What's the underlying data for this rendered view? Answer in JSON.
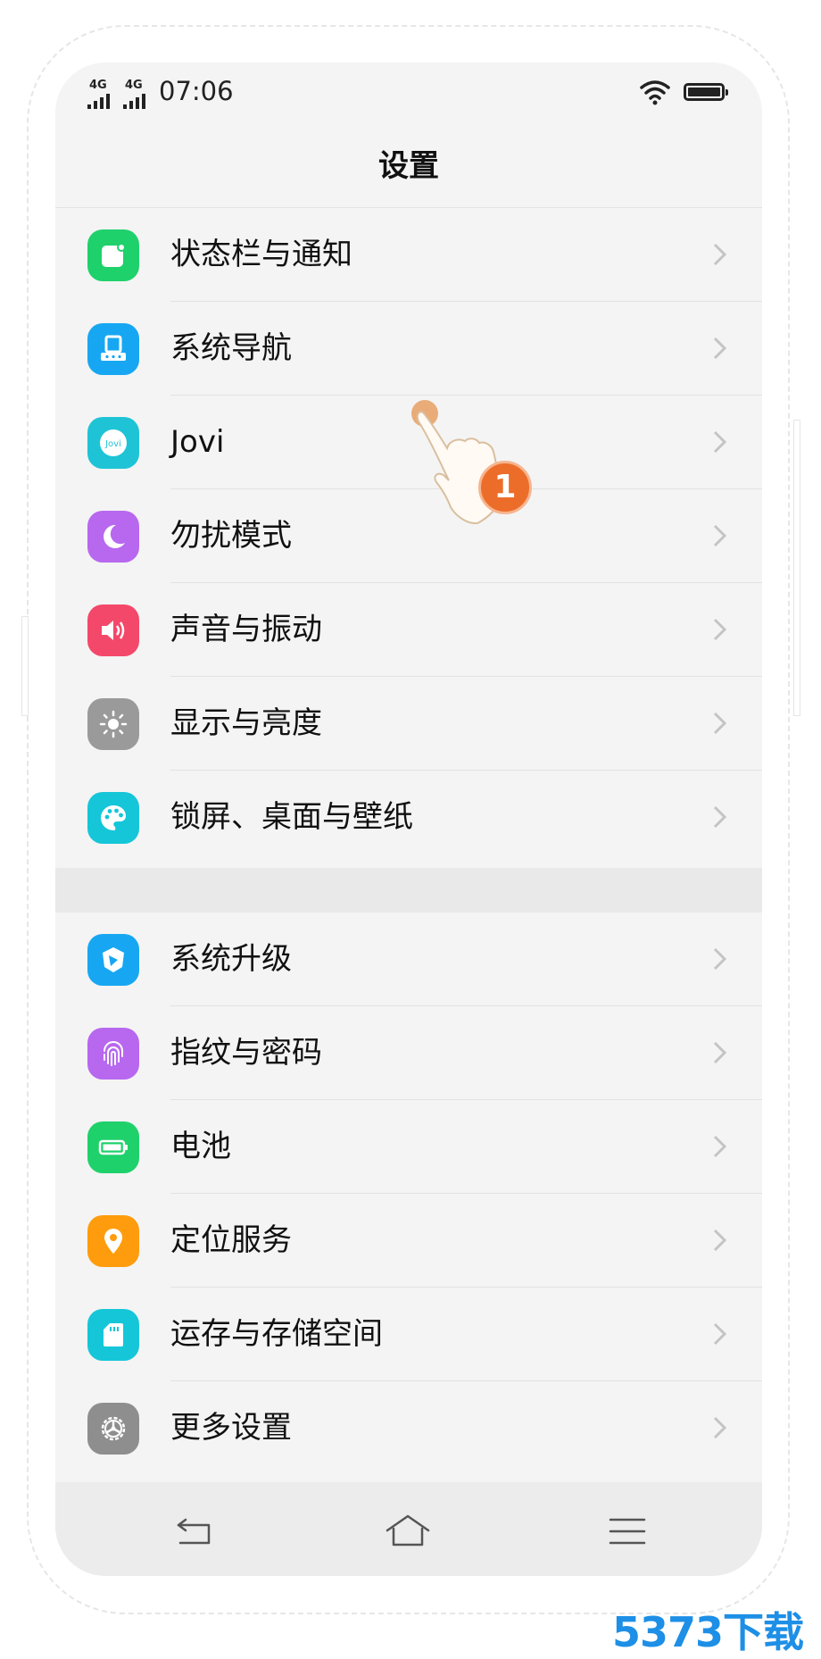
{
  "status_bar": {
    "sim1_tag": "4G",
    "sim2_tag": "4G",
    "time": "07:06",
    "icons": [
      "signal-icon",
      "signal-icon",
      "wifi-icon",
      "battery-icon"
    ]
  },
  "header": {
    "title": "设置"
  },
  "groups": [
    {
      "items": [
        {
          "label": "状态栏与通知",
          "icon": "notification-icon",
          "color": "#1fd16b"
        },
        {
          "label": "系统导航",
          "icon": "navigation-icon",
          "color": "#17a7f2"
        },
        {
          "label": "Jovi",
          "icon": "jovi-icon",
          "icon_text": "Jovi",
          "color": "#1ec4d6"
        },
        {
          "label": "勿扰模式",
          "icon": "moon-icon",
          "color": "#b768ef"
        },
        {
          "label": "声音与振动",
          "icon": "speaker-icon",
          "color": "#f4486a"
        },
        {
          "label": "显示与亮度",
          "icon": "brightness-icon",
          "color": "#9a9a9a"
        },
        {
          "label": "锁屏、桌面与壁纸",
          "icon": "palette-icon",
          "color": "#15c6d9"
        }
      ]
    },
    {
      "items": [
        {
          "label": "系统升级",
          "icon": "upgrade-icon",
          "color": "#17a7f2"
        },
        {
          "label": "指纹与密码",
          "icon": "fingerprint-icon",
          "color": "#b768ef"
        },
        {
          "label": "电池",
          "icon": "battery-icon",
          "color": "#1fd16b"
        },
        {
          "label": "定位服务",
          "icon": "location-icon",
          "color": "#ff9c0d"
        },
        {
          "label": "运存与存储空间",
          "icon": "sd-card-icon",
          "color": "#15c6d9"
        },
        {
          "label": "更多设置",
          "icon": "gear-icon",
          "color": "#8e8e8e"
        }
      ]
    }
  ],
  "tutorial": {
    "step_number": "1",
    "pointer_icon": "tap-hand-icon"
  },
  "nav_bar": {
    "icons": [
      "back-icon",
      "home-icon",
      "menu-icon"
    ]
  },
  "watermark": "5373下载",
  "colors": {
    "screen_bg": "#f4f4f4",
    "divider": "#e2e2e2",
    "step_badge": "#ec6d2a",
    "watermark": "#1d8fe6"
  }
}
